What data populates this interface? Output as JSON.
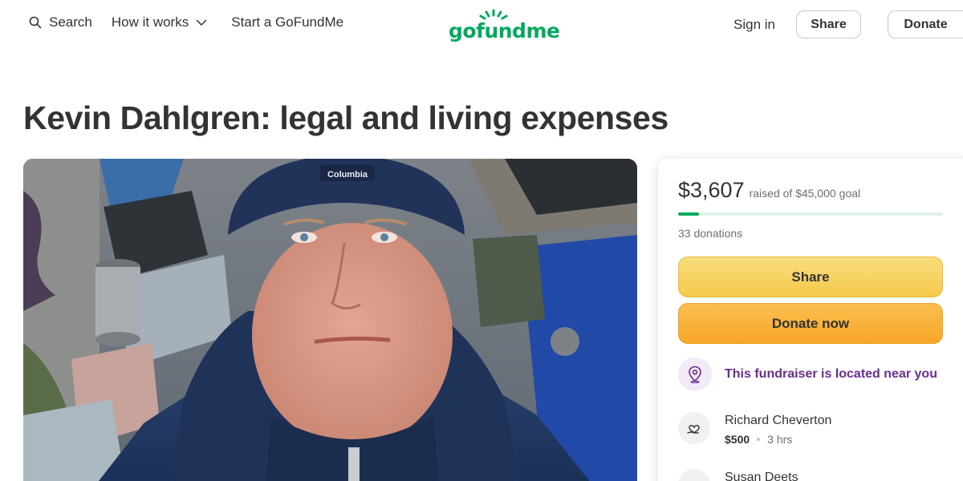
{
  "header": {
    "search_label": "Search",
    "how_it_works_label": "How it works",
    "start_label": "Start a GoFundMe",
    "logo_text": "gofundme",
    "sign_in_label": "Sign in",
    "share_label": "Share",
    "donate_label": "Donate"
  },
  "campaign": {
    "title": "Kevin Dahlgren: legal and living expenses",
    "hero_cap_brand": "Columbia"
  },
  "card": {
    "raised": "$3,607",
    "goal_text": "raised of $45,000 goal",
    "progress_fraction": 0.08,
    "donations_text": "33 donations",
    "share_button": "Share",
    "donate_button": "Donate now",
    "location_text": "This fundraiser is located near you",
    "donors": [
      {
        "name": "Richard Cheverton",
        "amount": "$500",
        "time": "3 hrs"
      },
      {
        "name": "Susan Deets"
      }
    ]
  },
  "colors": {
    "brand_green": "#02a95c",
    "share_yellow": "#f7d35c",
    "donate_orange": "#f8b03a",
    "location_purple": "#6b2c91"
  },
  "icons": [
    "search-icon",
    "chevron-down-icon",
    "map-pin-icon",
    "donation-heart-icon"
  ]
}
